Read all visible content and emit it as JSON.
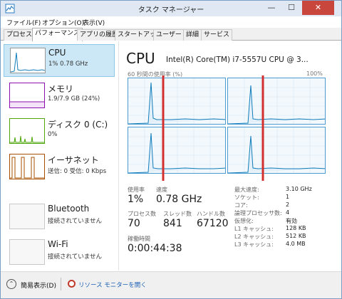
{
  "window": {
    "title": "タスク マネージャー",
    "min_glyph": "—",
    "max_glyph": "☐",
    "close_glyph": "✕"
  },
  "menu": [
    {
      "label": "ファイル(F)"
    },
    {
      "label": "オプション(O)"
    },
    {
      "label": "表示(V)"
    }
  ],
  "tabs": [
    {
      "label": "プロセス",
      "active": false
    },
    {
      "label": "パフォーマンス",
      "active": true
    },
    {
      "label": "アプリの履歴",
      "active": false
    },
    {
      "label": "スタートアップ",
      "active": false
    },
    {
      "label": "ユーザー",
      "active": false
    },
    {
      "label": "詳細",
      "active": false
    },
    {
      "label": "サービス",
      "active": false
    }
  ],
  "sidebar": {
    "items": [
      {
        "title": "CPU",
        "sub": "1% 0.78 GHz",
        "selected": true,
        "color": "#117dbb"
      },
      {
        "title": "メモリ",
        "sub": "1.9/7.9 GB (24%)",
        "selected": false,
        "color": "#8b12ae"
      },
      {
        "title": "ディスク 0 (C:)",
        "sub": "0%",
        "selected": false,
        "color": "#4da60c"
      },
      {
        "title": "イーサネット",
        "sub": "送信: 0 受信: 0 Kbps",
        "selected": false,
        "color": "#a74f01"
      },
      {
        "title": "Bluetooth",
        "sub": "接続されていません",
        "selected": false,
        "color": "#a0a0a0"
      },
      {
        "title": "Wi-Fi",
        "sub": "接続されていません",
        "selected": false,
        "color": "#a0a0a0"
      }
    ]
  },
  "main": {
    "title": "CPU",
    "model": "Intel(R) Core(TM) i7-5557U CPU @ 3...",
    "graph_label": "60 秒間の使用率 (%)",
    "graph_max": "100%",
    "graph_color": "#117dbb",
    "stats": {
      "utilization": {
        "label": "使用率",
        "value": "1%"
      },
      "speed": {
        "label": "速度",
        "value": "0.78 GHz"
      },
      "processes": {
        "label": "プロセス数",
        "value": "70"
      },
      "threads": {
        "label": "スレッド数",
        "value": "841"
      },
      "handles": {
        "label": "ハンドル数",
        "value": "67120"
      },
      "uptime": {
        "label": "稼働時間",
        "value": "0:00:44:38"
      }
    },
    "details": [
      {
        "key": "最大速度:",
        "value": "3.10 GHz"
      },
      {
        "key": "ソケット:",
        "value": "1"
      },
      {
        "key": "コア:",
        "value": "2"
      },
      {
        "key": "論理プロセッサ数:",
        "value": "4"
      },
      {
        "key": "仮想化:",
        "value": "有効"
      },
      {
        "key": "L1 キャッシュ:",
        "value": "128 KB"
      },
      {
        "key": "L2 キャッシュ:",
        "value": "512 KB"
      },
      {
        "key": "L3 キャッシュ:",
        "value": "4.0 MB"
      }
    ]
  },
  "footer": {
    "fewer_details": "簡易表示(D)",
    "resource_monitor": "リソース モニターを開く"
  }
}
